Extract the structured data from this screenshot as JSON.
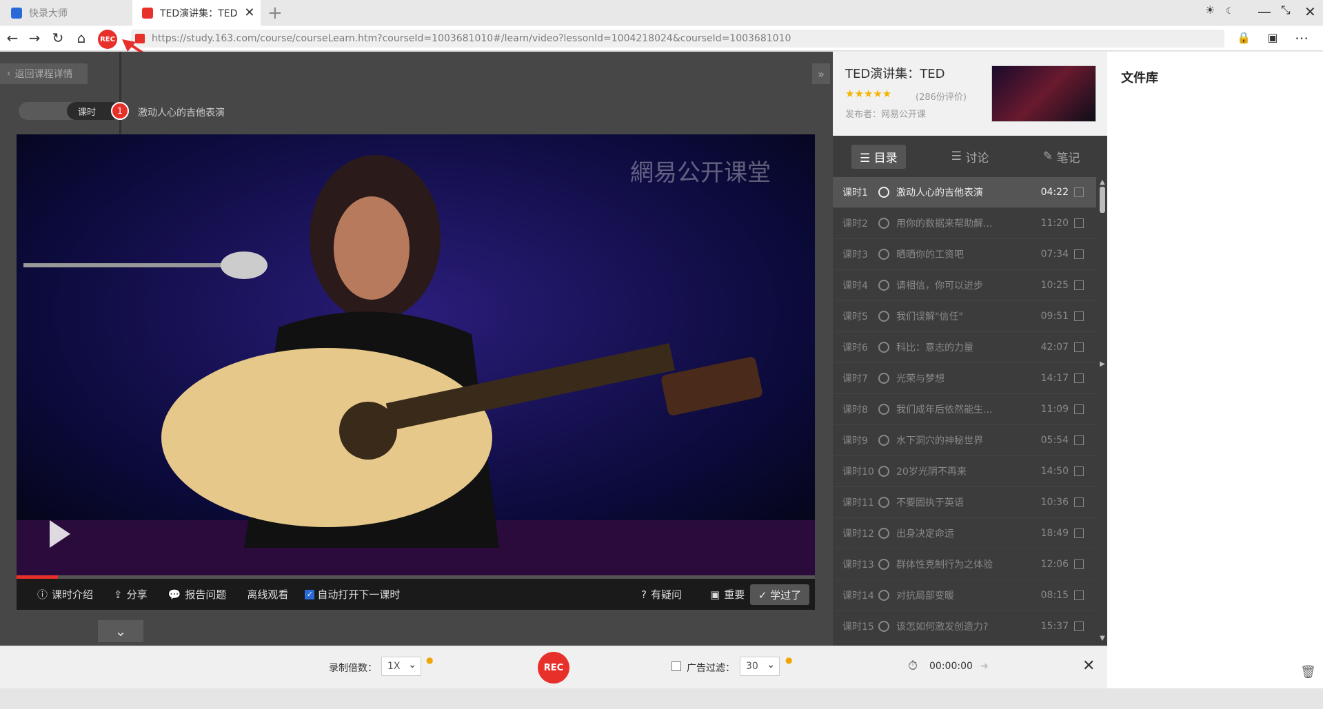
{
  "browser": {
    "tabs": [
      {
        "label": "快录大师",
        "active": false
      },
      {
        "label": "TED演讲集：TED",
        "active": true
      }
    ],
    "url": "https://study.163.com/course/courseLearn.htm?courseId=1003681010#/learn/video?lessonId=1004218024&courseId=1003681010",
    "rec_badge": "REC"
  },
  "player": {
    "back_label": "返回课程详情",
    "lesson_pill_label": "课时",
    "lesson_number": "1",
    "lesson_title": "激动人心的吉他表演",
    "watermark": "網易公开课堂",
    "controls": {
      "intro": "课时介绍",
      "share": "分享",
      "report": "报告问题",
      "offline": "离线观看",
      "autonext": "自动打开下一课时",
      "question": "有疑问",
      "important": "重要",
      "learned": "✓ 学过了"
    }
  },
  "course": {
    "title": "TED演讲集：TED",
    "stars": "★★★★★",
    "rating": "(286份评价)",
    "publisher": "发布者：网易公开课",
    "tabs": {
      "catalog": "目录",
      "discussion": "讨论",
      "notes": "笔记"
    },
    "lessons": [
      {
        "num": "课时1",
        "title": "激动人心的吉他表演",
        "duration": "04:22"
      },
      {
        "num": "课时2",
        "title": "用你的数据来帮助解...",
        "duration": "11:20"
      },
      {
        "num": "课时3",
        "title": "晒晒你的工资吧",
        "duration": "07:34"
      },
      {
        "num": "课时4",
        "title": "请相信，你可以进步",
        "duration": "10:25"
      },
      {
        "num": "课时5",
        "title": "我们误解\"信任\"",
        "duration": "09:51"
      },
      {
        "num": "课时6",
        "title": "科比：意志的力量",
        "duration": "42:07"
      },
      {
        "num": "课时7",
        "title": "光荣与梦想",
        "duration": "14:17"
      },
      {
        "num": "课时8",
        "title": "我们成年后依然能生...",
        "duration": "11:09"
      },
      {
        "num": "课时9",
        "title": "水下洞穴的神秘世界",
        "duration": "05:54"
      },
      {
        "num": "课时10",
        "title": "20岁光阴不再来",
        "duration": "14:50"
      },
      {
        "num": "课时11",
        "title": "不要固执于英语",
        "duration": "10:36"
      },
      {
        "num": "课时12",
        "title": "出身决定命运",
        "duration": "18:49"
      },
      {
        "num": "课时13",
        "title": "群体性克制行为之体验",
        "duration": "12:06"
      },
      {
        "num": "课时14",
        "title": "对抗局部变暖",
        "duration": "08:15"
      },
      {
        "num": "课时15",
        "title": "该怎如何激发创造力?",
        "duration": "15:37"
      }
    ]
  },
  "file_library": {
    "title": "文件库"
  },
  "rec_bar": {
    "speed_label": "录制倍数：",
    "speed_value": "1X",
    "rec_label": "REC",
    "ad_filter_label": "广告过滤：",
    "ad_filter_value": "30",
    "timer": "00:00:00"
  },
  "colors": {
    "accent": "#e7302a",
    "star": "#f4b400"
  }
}
